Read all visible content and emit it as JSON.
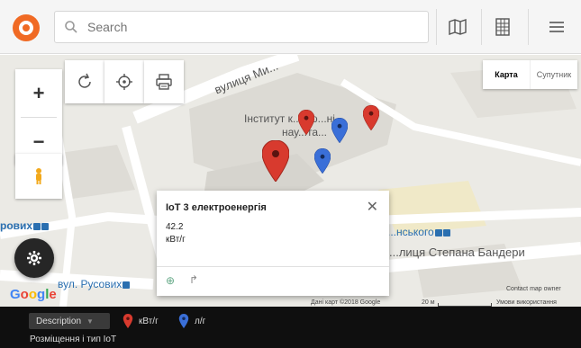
{
  "search": {
    "placeholder": "Search"
  },
  "map": {
    "street_label": "вулиця Ми...",
    "institute_label_line1": "Інститут к...п'ю...ні",
    "institute_label_line2": "нау...та...",
    "left_label": "ровиx",
    "bottom_left_street": "вул. Русових",
    "right_street": "...лиця Степана Бандери",
    "right_station": "...нського",
    "maptype": {
      "map": "Карта",
      "satellite": "Супутник"
    },
    "google": "Google",
    "attribution": "Дані карт ©2018 Google",
    "scale": "20 м",
    "terms": "Умови використання",
    "contact": "Contact map owner"
  },
  "popup": {
    "title": "IoT 3 електроенергія",
    "value": "42.2",
    "unit": "кВт/г"
  },
  "legend": {
    "description_label": "Description",
    "items": [
      {
        "label": "кВт/г",
        "color": "#d83a2e"
      },
      {
        "label": "л/г",
        "color": "#3a6fd8"
      }
    ],
    "caption": "Розміщення і тип IoT"
  },
  "colors": {
    "accent": "#f06a24",
    "marker_red": "#d83a2e",
    "marker_blue": "#3a6fd8"
  }
}
